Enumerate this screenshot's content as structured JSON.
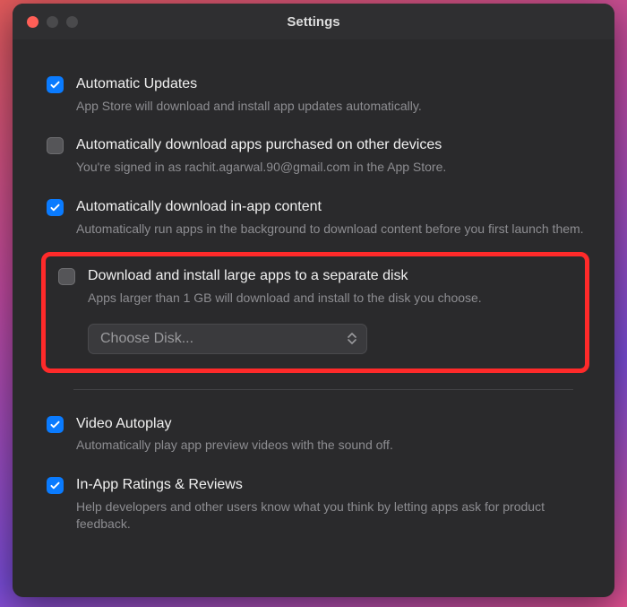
{
  "window": {
    "title": "Settings"
  },
  "settings": [
    {
      "checked": true,
      "label": "Automatic Updates",
      "desc": "App Store will download and install app updates automatically."
    },
    {
      "checked": false,
      "label": "Automatically download apps purchased on other devices",
      "desc": "You're signed in as rachit.agarwal.90@gmail.com in the App Store."
    },
    {
      "checked": true,
      "label": "Automatically download in-app content",
      "desc": "Automatically run apps in the background to download content before you first launch them."
    },
    {
      "checked": false,
      "label": "Download and install large apps to a separate disk",
      "desc": "Apps larger than 1 GB will download and install to the disk you choose.",
      "select_placeholder": "Choose Disk..."
    },
    {
      "checked": true,
      "label": "Video Autoplay",
      "desc": "Automatically play app preview videos with the sound off."
    },
    {
      "checked": true,
      "label": "In-App Ratings & Reviews",
      "desc": "Help developers and other users know what you think by letting apps ask for product feedback."
    }
  ]
}
